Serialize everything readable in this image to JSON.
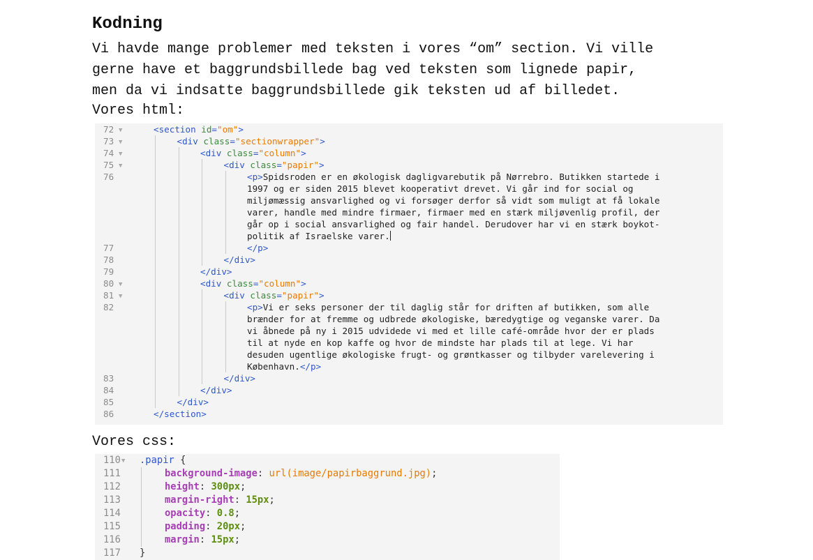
{
  "heading": "Kodning",
  "paragraph_lines": [
    "Vi havde mange problemer med teksten i vores “om” section. Vi ville",
    "gerne have et baggrundsbillede bag ved teksten som lignede papir,",
    "men da vi indsatte baggrundsbillede gik teksten ud af billedet."
  ],
  "html_label": "Vores html:",
  "css_label": "Vores css:",
  "html_code": [
    {
      "n": "72",
      "fold": true,
      "indent": 0,
      "tokens": [
        [
          "tag",
          "<section "
        ],
        [
          "attr",
          "id"
        ],
        [
          "tag",
          "="
        ],
        [
          "val",
          "\"om\""
        ],
        [
          "tag",
          ">"
        ]
      ]
    },
    {
      "n": "73",
      "fold": true,
      "indent": 1,
      "tokens": [
        [
          "tag",
          "<div "
        ],
        [
          "attr",
          "class"
        ],
        [
          "tag",
          "="
        ],
        [
          "val",
          "\"sectionwrapper\""
        ],
        [
          "tag",
          ">"
        ]
      ]
    },
    {
      "n": "74",
      "fold": true,
      "indent": 2,
      "tokens": [
        [
          "tag",
          "<div "
        ],
        [
          "attr",
          "class"
        ],
        [
          "tag",
          "="
        ],
        [
          "val",
          "\"column\""
        ],
        [
          "tag",
          ">"
        ]
      ]
    },
    {
      "n": "75",
      "fold": true,
      "indent": 3,
      "tokens": [
        [
          "tag",
          "<div "
        ],
        [
          "attr",
          "class"
        ],
        [
          "tag",
          "="
        ],
        [
          "val",
          "\"papir\""
        ],
        [
          "tag",
          ">"
        ]
      ]
    },
    {
      "n": "76",
      "fold": false,
      "indent": 4,
      "tokens": [
        [
          "tag",
          "<p>"
        ],
        [
          "text",
          "Spidsroden er en økologisk dagligvarebutik på Nørrebro. Butikken startede i"
        ]
      ]
    },
    {
      "n": "",
      "fold": false,
      "indent": 4,
      "tokens": [
        [
          "text",
          "1997 og er siden 2015 blevet kooperativt drevet. Vi går ind for social og"
        ]
      ]
    },
    {
      "n": "",
      "fold": false,
      "indent": 4,
      "tokens": [
        [
          "text",
          "miljømæssig ansvarlighed og vi forsøger derfor så vidt som muligt at få lokale"
        ]
      ]
    },
    {
      "n": "",
      "fold": false,
      "indent": 4,
      "tokens": [
        [
          "text",
          "varer, handle med mindre firmaer, firmaer med en stærk miljøvenlig profil, der"
        ]
      ]
    },
    {
      "n": "",
      "fold": false,
      "indent": 4,
      "tokens": [
        [
          "text",
          "går op i social ansvarlighed og fair handel. Derudover har vi en stærk boykot-"
        ]
      ]
    },
    {
      "n": "",
      "fold": false,
      "indent": 4,
      "caret": true,
      "tokens": [
        [
          "text",
          "politik af Israelske varer."
        ]
      ]
    },
    {
      "n": "77",
      "fold": false,
      "indent": 4,
      "tokens": [
        [
          "tag",
          "</p>"
        ]
      ]
    },
    {
      "n": "78",
      "fold": false,
      "indent": 3,
      "tokens": [
        [
          "tag",
          "</div>"
        ]
      ]
    },
    {
      "n": "79",
      "fold": false,
      "indent": 2,
      "tokens": [
        [
          "tag",
          "</div>"
        ]
      ]
    },
    {
      "n": "80",
      "fold": true,
      "indent": 2,
      "tokens": [
        [
          "tag",
          "<div "
        ],
        [
          "attr",
          "class"
        ],
        [
          "tag",
          "="
        ],
        [
          "val",
          "\"column\""
        ],
        [
          "tag",
          ">"
        ]
      ]
    },
    {
      "n": "81",
      "fold": true,
      "indent": 3,
      "tokens": [
        [
          "tag",
          "<div "
        ],
        [
          "attr",
          "class"
        ],
        [
          "tag",
          "="
        ],
        [
          "val",
          "\"papir\""
        ],
        [
          "tag",
          ">"
        ]
      ]
    },
    {
      "n": "82",
      "fold": false,
      "indent": 4,
      "tokens": [
        [
          "tag",
          "<p>"
        ],
        [
          "text",
          "Vi er seks personer der til daglig står for driften af butikken, som alle"
        ]
      ]
    },
    {
      "n": "",
      "fold": false,
      "indent": 4,
      "tokens": [
        [
          "text",
          "brænder for at fremme og udbrede økologiske, bæredygtige og veganske varer. Da"
        ]
      ]
    },
    {
      "n": "",
      "fold": false,
      "indent": 4,
      "tokens": [
        [
          "text",
          "vi åbnede på ny i 2015 udvidede vi med et lille café-område hvor der er plads"
        ]
      ]
    },
    {
      "n": "",
      "fold": false,
      "indent": 4,
      "tokens": [
        [
          "text",
          "til at nyde en kop kaffe og hvor de mindste har plads til at lege. Vi har"
        ]
      ]
    },
    {
      "n": "",
      "fold": false,
      "indent": 4,
      "tokens": [
        [
          "text",
          "desuden ugentlige økologiske frugt- og grøntkasser og tilbyder varelevering i"
        ]
      ]
    },
    {
      "n": "",
      "fold": false,
      "indent": 4,
      "tokens": [
        [
          "text",
          "København."
        ],
        [
          "tag",
          "</p>"
        ]
      ]
    },
    {
      "n": "83",
      "fold": false,
      "indent": 3,
      "tokens": [
        [
          "tag",
          "</div>"
        ]
      ]
    },
    {
      "n": "84",
      "fold": false,
      "indent": 2,
      "tokens": [
        [
          "tag",
          "</div>"
        ]
      ]
    },
    {
      "n": "85",
      "fold": false,
      "indent": 1,
      "tokens": [
        [
          "tag",
          "</div>"
        ]
      ]
    },
    {
      "n": "86",
      "fold": false,
      "indent": 0,
      "tokens": [
        [
          "tag",
          "</section>"
        ]
      ]
    }
  ],
  "css_code": [
    {
      "n": "110",
      "fold": true,
      "indent": 0,
      "tokens": [
        [
          "sel",
          ".papir"
        ],
        [
          "punc",
          " {"
        ]
      ]
    },
    {
      "n": "111",
      "fold": false,
      "indent": 1,
      "tokens": [
        [
          "prop",
          "background-image"
        ],
        [
          "punc",
          ": "
        ],
        [
          "val",
          "url(image/papirbaggrund.jpg)"
        ],
        [
          "punc",
          ";"
        ]
      ]
    },
    {
      "n": "112",
      "fold": false,
      "indent": 1,
      "tokens": [
        [
          "prop",
          "height"
        ],
        [
          "punc",
          ": "
        ],
        [
          "num",
          "300px"
        ],
        [
          "punc",
          ";"
        ]
      ]
    },
    {
      "n": "113",
      "fold": false,
      "indent": 1,
      "tokens": [
        [
          "prop",
          "margin-right"
        ],
        [
          "punc",
          ": "
        ],
        [
          "num",
          "15px"
        ],
        [
          "punc",
          ";"
        ]
      ]
    },
    {
      "n": "114",
      "fold": false,
      "indent": 1,
      "tokens": [
        [
          "prop",
          "opacity"
        ],
        [
          "punc",
          ": "
        ],
        [
          "num",
          "0.8"
        ],
        [
          "punc",
          ";"
        ]
      ]
    },
    {
      "n": "115",
      "fold": false,
      "indent": 1,
      "tokens": [
        [
          "prop",
          "padding"
        ],
        [
          "punc",
          ": "
        ],
        [
          "num",
          "20px"
        ],
        [
          "punc",
          ";"
        ]
      ]
    },
    {
      "n": "116",
      "fold": false,
      "indent": 1,
      "tokens": [
        [
          "prop",
          "margin"
        ],
        [
          "punc",
          ": "
        ],
        [
          "num",
          "15px"
        ],
        [
          "punc",
          ";"
        ]
      ]
    },
    {
      "n": "117",
      "fold": false,
      "indent": 0,
      "tokens": [
        [
          "punc",
          "}"
        ]
      ]
    }
  ]
}
